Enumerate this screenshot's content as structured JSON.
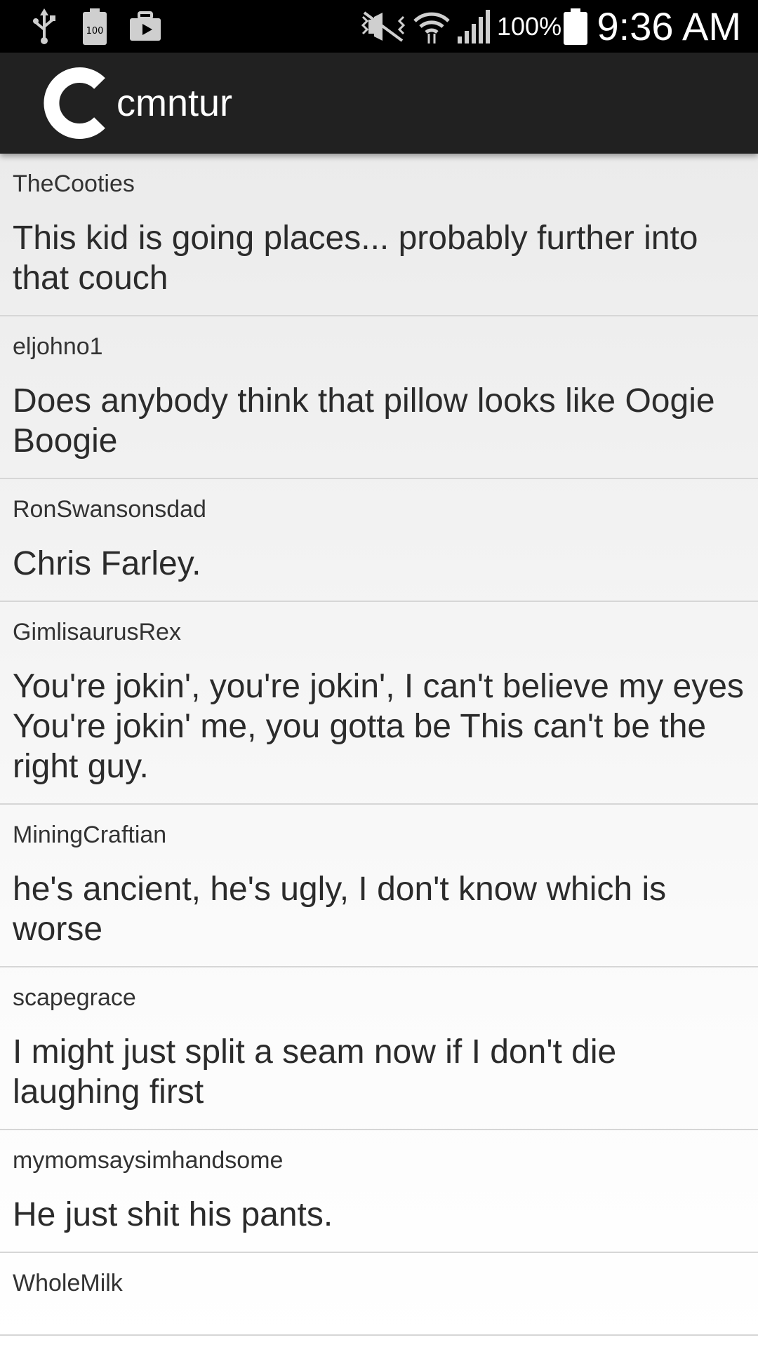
{
  "status_bar": {
    "battery_percent": "100%",
    "time": "9:36 AM",
    "icons": [
      "usb-icon",
      "battery-100-icon",
      "briefcase-play-icon",
      "mute-icon",
      "wifi-icon",
      "signal-icon",
      "battery-icon"
    ]
  },
  "app_bar": {
    "logo_letter": "C",
    "title": "cmntur",
    "background_color": "#212121"
  },
  "comments": [
    {
      "author": "TheCooties",
      "text": "This kid is going places... probably further into that couch"
    },
    {
      "author": "eljohno1",
      "text": "Does anybody think that pillow looks like Oogie Boogie"
    },
    {
      "author": "RonSwansonsdad",
      "text": "Chris Farley."
    },
    {
      "author": "GimlisaurusRex",
      "text": "You're jokin', you're jokin', I can't believe my eyes You're jokin' me, you gotta be This can't be the right guy."
    },
    {
      "author": "MiningCraftian",
      "text": "he's ancient, he's ugly, I don't know which is worse"
    },
    {
      "author": "scapegrace",
      "text": "I might just split a seam now if I don't die laughing first"
    },
    {
      "author": "mymomsaysimhandsome",
      "text": "He just shit his pants."
    },
    {
      "author": "WholeMilk",
      "text": ""
    }
  ]
}
